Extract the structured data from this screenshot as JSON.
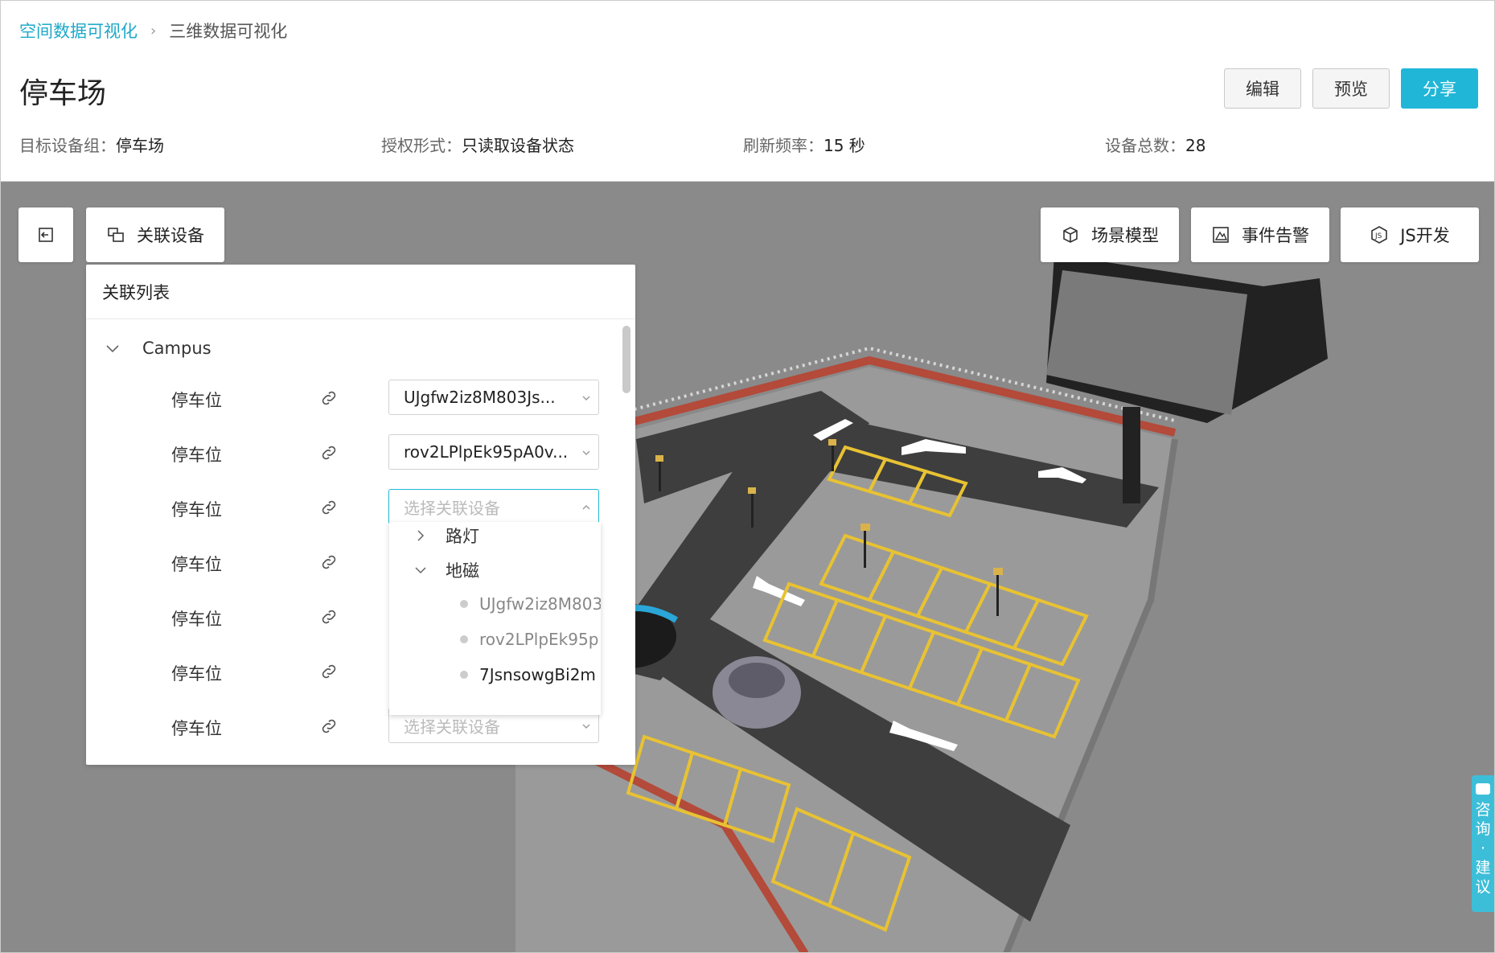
{
  "breadcrumb": {
    "parent": "空间数据可视化",
    "current": "三维数据可视化"
  },
  "title": "停车场",
  "actions": {
    "edit": "编辑",
    "preview": "预览",
    "share": "分享"
  },
  "meta": [
    {
      "key": "目标设备组：",
      "value": "停车场"
    },
    {
      "key": "授权形式：",
      "value": "只读取设备状态"
    },
    {
      "key": "刷新频率：",
      "value": "15 秒"
    },
    {
      "key": "设备总数：",
      "value": "28"
    }
  ],
  "toolbar": {
    "related_devices": "关联设备",
    "scene_model": "场景模型",
    "event_alarm": "事件告警",
    "js_dev": "JS开发"
  },
  "panel": {
    "title": "关联列表",
    "root": "Campus",
    "rows": [
      {
        "label": "停车位",
        "value": "UJgfw2iz8M803Js...",
        "placeholder": false
      },
      {
        "label": "停车位",
        "value": "rov2LPlpEk95pA0v...",
        "placeholder": false
      },
      {
        "label": "停车位",
        "value": "选择关联设备",
        "placeholder": true
      },
      {
        "label": "停车位",
        "value": "",
        "placeholder": false
      },
      {
        "label": "停车位",
        "value": "",
        "placeholder": false
      },
      {
        "label": "停车位",
        "value": "",
        "placeholder": false
      },
      {
        "label": "停车位",
        "value": "选择关联设备",
        "placeholder": true
      }
    ]
  },
  "dropdown": {
    "groups": [
      {
        "label": "路灯",
        "expanded": false
      },
      {
        "label": "地磁",
        "expanded": true
      }
    ],
    "devices": [
      "UJgfw2iz8M803",
      "rov2LPlpEk95p",
      "7JsnsowgBi2m"
    ]
  },
  "consult": {
    "chars": [
      "咨",
      "询",
      "·",
      "建",
      "议"
    ]
  },
  "colors": {
    "accent": "#1fb6d8",
    "link": "#1fa9c9"
  }
}
